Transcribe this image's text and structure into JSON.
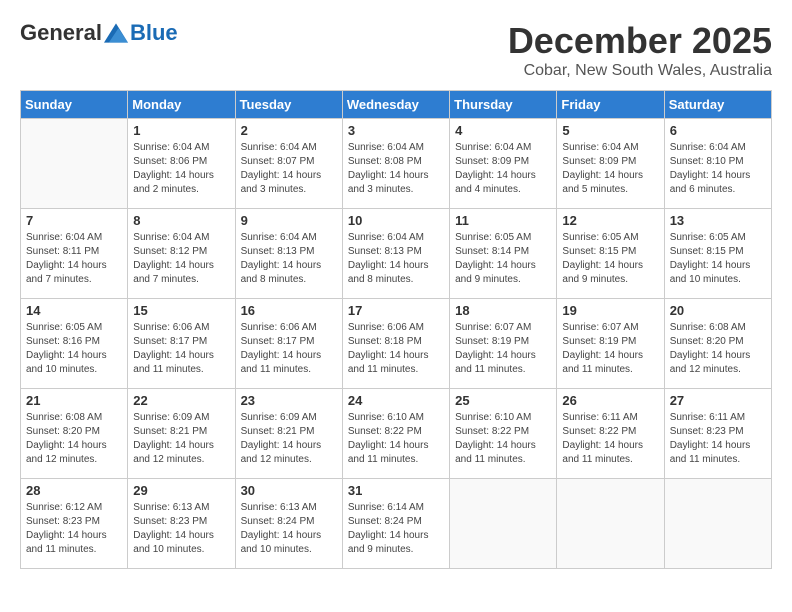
{
  "header": {
    "logo_general": "General",
    "logo_blue": "Blue",
    "month_title": "December 2025",
    "location": "Cobar, New South Wales, Australia"
  },
  "days_of_week": [
    "Sunday",
    "Monday",
    "Tuesday",
    "Wednesday",
    "Thursday",
    "Friday",
    "Saturday"
  ],
  "weeks": [
    [
      {
        "day": "",
        "info": ""
      },
      {
        "day": "1",
        "info": "Sunrise: 6:04 AM\nSunset: 8:06 PM\nDaylight: 14 hours\nand 2 minutes."
      },
      {
        "day": "2",
        "info": "Sunrise: 6:04 AM\nSunset: 8:07 PM\nDaylight: 14 hours\nand 3 minutes."
      },
      {
        "day": "3",
        "info": "Sunrise: 6:04 AM\nSunset: 8:08 PM\nDaylight: 14 hours\nand 3 minutes."
      },
      {
        "day": "4",
        "info": "Sunrise: 6:04 AM\nSunset: 8:09 PM\nDaylight: 14 hours\nand 4 minutes."
      },
      {
        "day": "5",
        "info": "Sunrise: 6:04 AM\nSunset: 8:09 PM\nDaylight: 14 hours\nand 5 minutes."
      },
      {
        "day": "6",
        "info": "Sunrise: 6:04 AM\nSunset: 8:10 PM\nDaylight: 14 hours\nand 6 minutes."
      }
    ],
    [
      {
        "day": "7",
        "info": "Sunrise: 6:04 AM\nSunset: 8:11 PM\nDaylight: 14 hours\nand 7 minutes."
      },
      {
        "day": "8",
        "info": "Sunrise: 6:04 AM\nSunset: 8:12 PM\nDaylight: 14 hours\nand 7 minutes."
      },
      {
        "day": "9",
        "info": "Sunrise: 6:04 AM\nSunset: 8:13 PM\nDaylight: 14 hours\nand 8 minutes."
      },
      {
        "day": "10",
        "info": "Sunrise: 6:04 AM\nSunset: 8:13 PM\nDaylight: 14 hours\nand 8 minutes."
      },
      {
        "day": "11",
        "info": "Sunrise: 6:05 AM\nSunset: 8:14 PM\nDaylight: 14 hours\nand 9 minutes."
      },
      {
        "day": "12",
        "info": "Sunrise: 6:05 AM\nSunset: 8:15 PM\nDaylight: 14 hours\nand 9 minutes."
      },
      {
        "day": "13",
        "info": "Sunrise: 6:05 AM\nSunset: 8:15 PM\nDaylight: 14 hours\nand 10 minutes."
      }
    ],
    [
      {
        "day": "14",
        "info": "Sunrise: 6:05 AM\nSunset: 8:16 PM\nDaylight: 14 hours\nand 10 minutes."
      },
      {
        "day": "15",
        "info": "Sunrise: 6:06 AM\nSunset: 8:17 PM\nDaylight: 14 hours\nand 11 minutes."
      },
      {
        "day": "16",
        "info": "Sunrise: 6:06 AM\nSunset: 8:17 PM\nDaylight: 14 hours\nand 11 minutes."
      },
      {
        "day": "17",
        "info": "Sunrise: 6:06 AM\nSunset: 8:18 PM\nDaylight: 14 hours\nand 11 minutes."
      },
      {
        "day": "18",
        "info": "Sunrise: 6:07 AM\nSunset: 8:19 PM\nDaylight: 14 hours\nand 11 minutes."
      },
      {
        "day": "19",
        "info": "Sunrise: 6:07 AM\nSunset: 8:19 PM\nDaylight: 14 hours\nand 11 minutes."
      },
      {
        "day": "20",
        "info": "Sunrise: 6:08 AM\nSunset: 8:20 PM\nDaylight: 14 hours\nand 12 minutes."
      }
    ],
    [
      {
        "day": "21",
        "info": "Sunrise: 6:08 AM\nSunset: 8:20 PM\nDaylight: 14 hours\nand 12 minutes."
      },
      {
        "day": "22",
        "info": "Sunrise: 6:09 AM\nSunset: 8:21 PM\nDaylight: 14 hours\nand 12 minutes."
      },
      {
        "day": "23",
        "info": "Sunrise: 6:09 AM\nSunset: 8:21 PM\nDaylight: 14 hours\nand 12 minutes."
      },
      {
        "day": "24",
        "info": "Sunrise: 6:10 AM\nSunset: 8:22 PM\nDaylight: 14 hours\nand 11 minutes."
      },
      {
        "day": "25",
        "info": "Sunrise: 6:10 AM\nSunset: 8:22 PM\nDaylight: 14 hours\nand 11 minutes."
      },
      {
        "day": "26",
        "info": "Sunrise: 6:11 AM\nSunset: 8:22 PM\nDaylight: 14 hours\nand 11 minutes."
      },
      {
        "day": "27",
        "info": "Sunrise: 6:11 AM\nSunset: 8:23 PM\nDaylight: 14 hours\nand 11 minutes."
      }
    ],
    [
      {
        "day": "28",
        "info": "Sunrise: 6:12 AM\nSunset: 8:23 PM\nDaylight: 14 hours\nand 11 minutes."
      },
      {
        "day": "29",
        "info": "Sunrise: 6:13 AM\nSunset: 8:23 PM\nDaylight: 14 hours\nand 10 minutes."
      },
      {
        "day": "30",
        "info": "Sunrise: 6:13 AM\nSunset: 8:24 PM\nDaylight: 14 hours\nand 10 minutes."
      },
      {
        "day": "31",
        "info": "Sunrise: 6:14 AM\nSunset: 8:24 PM\nDaylight: 14 hours\nand 9 minutes."
      },
      {
        "day": "",
        "info": ""
      },
      {
        "day": "",
        "info": ""
      },
      {
        "day": "",
        "info": ""
      }
    ]
  ]
}
